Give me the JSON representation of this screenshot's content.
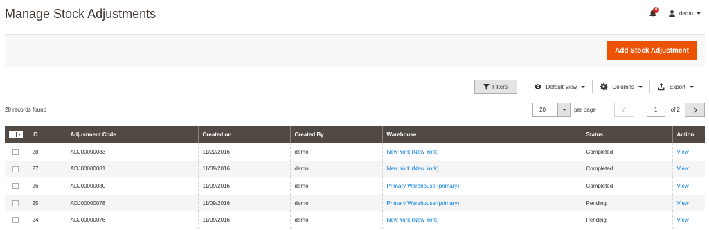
{
  "header": {
    "title": "Manage Stock Adjustments",
    "notification_count": "4",
    "username": "demo"
  },
  "actions": {
    "add_label": "Add Stock Adjustment"
  },
  "toolbar": {
    "filters_label": "Filters",
    "view_label": "Default View",
    "columns_label": "Columns",
    "export_label": "Export"
  },
  "records_found": "28 records found",
  "pager": {
    "per_page_value": "20",
    "per_page_label": "per page",
    "current_page": "1",
    "total_pages_label": "of 2"
  },
  "grid": {
    "columns": [
      "ID",
      "Adjustment Code",
      "Created on",
      "Created By",
      "Warehouse",
      "Status",
      "Action"
    ],
    "rows": [
      {
        "id": "28",
        "code": "ADJ00000083",
        "created_on": "11/22/2016",
        "created_by": "demo",
        "warehouse": "New York (New York)",
        "status": "Completed",
        "action": "View"
      },
      {
        "id": "27",
        "code": "ADJ00000081",
        "created_on": "11/09/2016",
        "created_by": "demo",
        "warehouse": "New York (New York)",
        "status": "Completed",
        "action": "View"
      },
      {
        "id": "26",
        "code": "ADJ00000080",
        "created_on": "11/09/2016",
        "created_by": "demo",
        "warehouse": "Primary Warehouse (primary)",
        "status": "Completed",
        "action": "View"
      },
      {
        "id": "25",
        "code": "ADJ00000078",
        "created_on": "11/09/2016",
        "created_by": "demo",
        "warehouse": "Primary Warehouse (primary)",
        "status": "Pending",
        "action": "View"
      },
      {
        "id": "24",
        "code": "ADJ00000076",
        "created_on": "11/09/2016",
        "created_by": "demo",
        "warehouse": "New York (New York)",
        "status": "Pending",
        "action": "View"
      }
    ]
  },
  "colors": {
    "accent": "#eb5202",
    "header_bg": "#514943",
    "link": "#007bdb",
    "badge": "#e22626"
  },
  "icons": [
    "bell-icon",
    "user-icon",
    "filter-icon",
    "eye-icon",
    "gear-icon",
    "export-icon",
    "chevron-left-icon",
    "chevron-right-icon"
  ]
}
